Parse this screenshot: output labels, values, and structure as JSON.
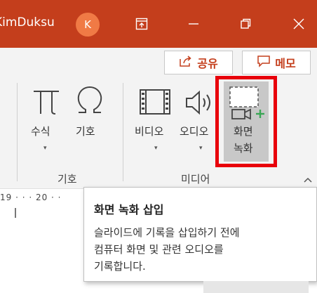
{
  "titlebar": {
    "user_name": "KimDuksu",
    "avatar_initial": "K",
    "icons": [
      "ribbon-display-icon",
      "minimize-icon",
      "restore-icon",
      "close-icon"
    ]
  },
  "actions": {
    "share_label": "공유",
    "memo_label": "메모"
  },
  "ribbon": {
    "groups": [
      {
        "label": "기호",
        "buttons": [
          {
            "label": "수식",
            "icon": "pi-icon"
          },
          {
            "label": "기호",
            "icon": "omega-icon"
          }
        ]
      },
      {
        "label": "미디어",
        "buttons": [
          {
            "label": "비디오",
            "icon": "film-icon"
          },
          {
            "label": "오디오",
            "icon": "speaker-icon"
          },
          {
            "label_line1": "화면",
            "label_line2": "녹화",
            "icon": "screen-recording-icon"
          }
        ]
      }
    ]
  },
  "ruler": {
    "text": "19 · · · 20 · ·"
  },
  "tooltip": {
    "title": "화면 녹화 삽입",
    "lines": [
      "슬라이드에 기록을 삽입하기 전에",
      "컴퓨터 화면 및 관련 오디오를",
      "기록합니다."
    ]
  },
  "colors": {
    "accent": "#c43e1c",
    "highlight": "#e8000b",
    "ribbon_bg": "#f3f3f3",
    "plus_green": "#3aa655"
  }
}
